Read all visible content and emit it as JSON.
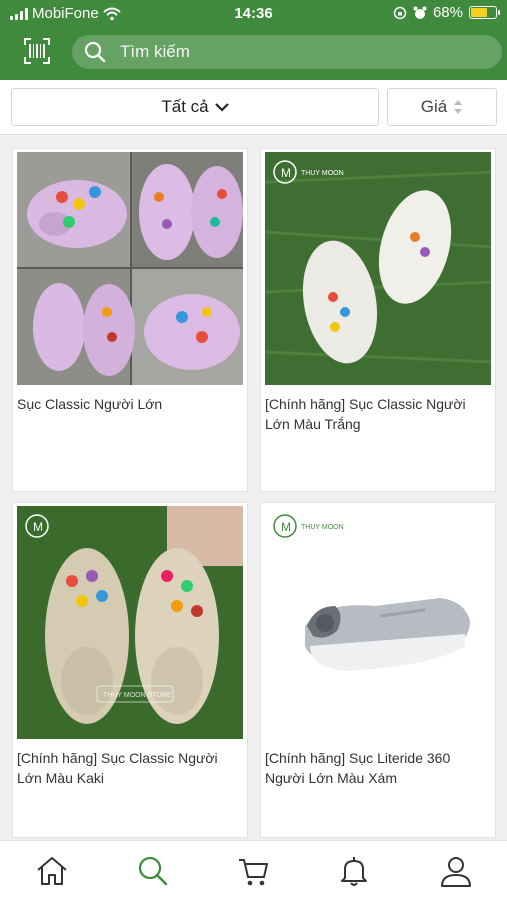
{
  "status_bar": {
    "carrier": "MobiFone",
    "time": "14:36",
    "battery": "68%",
    "battery_level": 0.68
  },
  "header": {
    "search_placeholder": "Tìm kiếm",
    "barcode_icon": "barcode-scan-icon",
    "search_icon": "search-icon"
  },
  "filters": {
    "category_label": "Tất cả",
    "price_label": "Giá"
  },
  "products": [
    {
      "title": "Sục Classic Người Lớn"
    },
    {
      "title": "[Chính hãng] Sục Classic Người Lớn Màu Trắng",
      "brand": "THUY MOON"
    },
    {
      "title": "[Chính hãng] Sục Classic Người Lớn Màu Kaki",
      "watermark": "THUY MOON STORE"
    },
    {
      "title": "[Chính hãng] Sục Literide 360 Người Lớn Màu Xám",
      "brand": "THUY MOON"
    }
  ],
  "bottom_nav": {
    "items": [
      "home-icon",
      "search-icon",
      "cart-icon",
      "bell-icon",
      "user-icon"
    ],
    "active": "search-icon",
    "active_color": "#3f8a3c"
  },
  "colors": {
    "brand": "#3f8a3c"
  }
}
